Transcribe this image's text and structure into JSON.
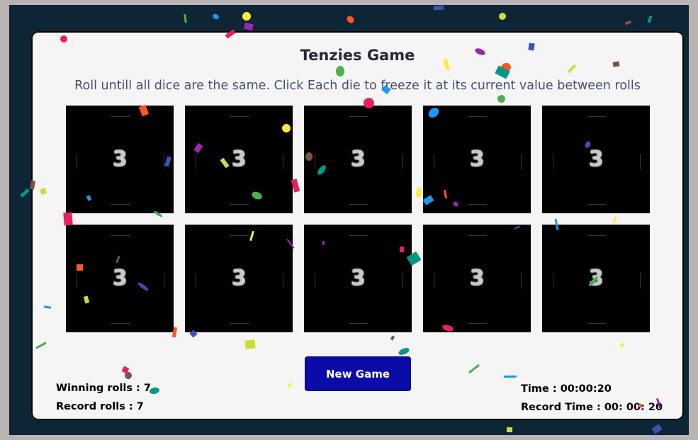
{
  "game": {
    "title": "Tenzies Game",
    "instructions": "Roll untill all dice are the same. Click Each die to freeze it at its current value between rolls",
    "dice": [
      {
        "value": "3"
      },
      {
        "value": "3"
      },
      {
        "value": "3"
      },
      {
        "value": "3"
      },
      {
        "value": "3"
      },
      {
        "value": "3"
      },
      {
        "value": "3"
      },
      {
        "value": "3"
      },
      {
        "value": "3"
      },
      {
        "value": "3"
      }
    ],
    "new_game_label": "New Game"
  },
  "stats": {
    "winning_rolls": "Winning rolls : 7",
    "record_rolls": "Record rolls : 7",
    "time": "Time : 00:00:20",
    "record_time": "Record Time : 00: 00: 20"
  },
  "colors": {
    "background_frame": "#0d2535",
    "card": "#f5f5f5",
    "die": "#000000",
    "button": "#0b0ba8",
    "confetti": [
      "#e91e63",
      "#4caf50",
      "#2196f3",
      "#ffeb3b",
      "#9c27b0",
      "#ff5722",
      "#3f51b5",
      "#cddc39",
      "#795548",
      "#009688"
    ]
  }
}
